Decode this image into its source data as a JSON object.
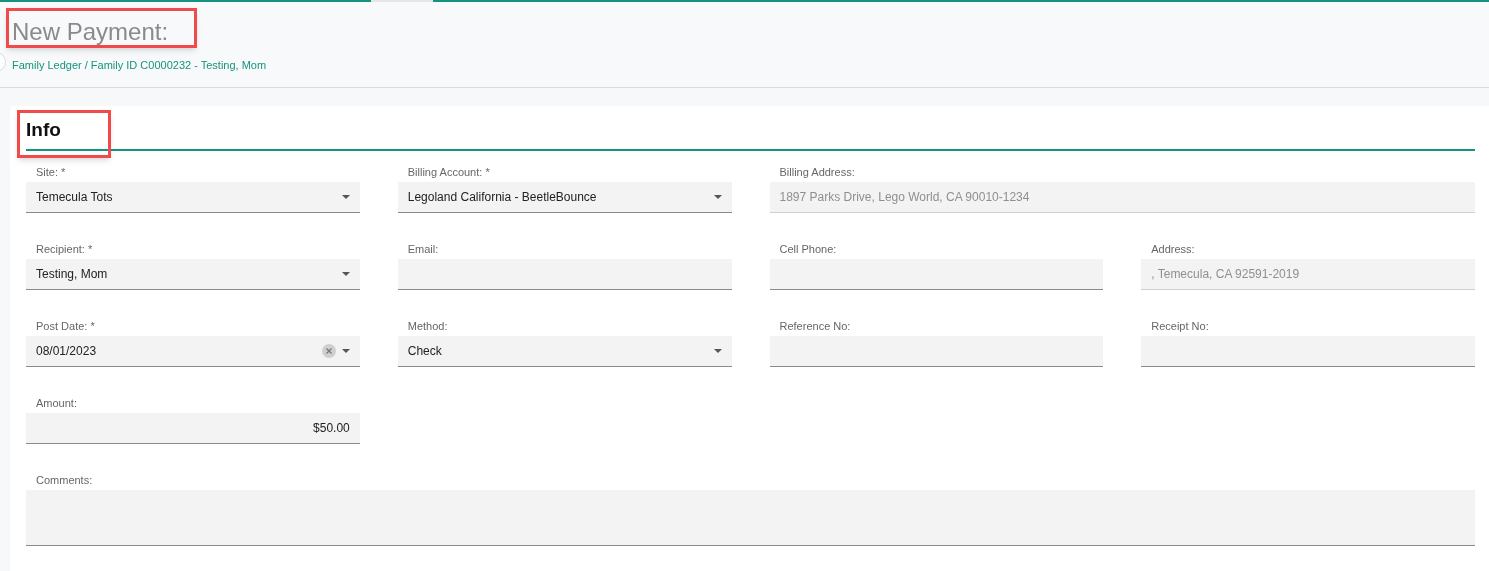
{
  "header": {
    "title": "New Payment:",
    "title_highlighted": true,
    "breadcrumb": "Family Ledger / Family ID C0000232 - Testing, Mom"
  },
  "section": {
    "title": "Info",
    "highlighted": true
  },
  "rows": [
    {
      "fields": [
        {
          "label": "Site: *",
          "kind": "select",
          "value": "Temecula Tots",
          "disabled": false
        },
        {
          "label": "Billing Account: *",
          "kind": "select",
          "value": "Legoland California - BeetleBounce",
          "disabled": false
        },
        {
          "label": "Billing Address:",
          "kind": "text",
          "value": "1897 Parks Drive, Lego World, CA 90010-1234",
          "disabled": true
        }
      ]
    },
    {
      "fields": [
        {
          "label": "Recipient: *",
          "kind": "select",
          "value": "Testing, Mom",
          "disabled": false
        },
        {
          "label": "Email:",
          "kind": "text",
          "disabled": false
        },
        {
          "label": "Cell Phone:",
          "kind": "text",
          "disabled": false
        },
        {
          "label": "Address:",
          "kind": "text",
          "value": ", Temecula, CA 92591-2019",
          "disabled": true
        }
      ]
    },
    {
      "fields": [
        {
          "label": "Post Date: *",
          "kind": "date",
          "value": "08/01/2023",
          "disabled": false
        },
        {
          "label": "Method:",
          "kind": "select",
          "value": "Check",
          "disabled": false
        },
        {
          "label": "Reference No:",
          "kind": "text",
          "disabled": false
        },
        {
          "label": "Receipt No:",
          "kind": "text",
          "disabled": false
        }
      ]
    },
    {
      "fields": [
        {
          "label": "Amount:",
          "kind": "amount",
          "value": "$50.00",
          "disabled": false
        }
      ]
    },
    {
      "fields": [
        {
          "label": "Comments:",
          "kind": "textarea",
          "disabled": false
        }
      ]
    }
  ]
}
